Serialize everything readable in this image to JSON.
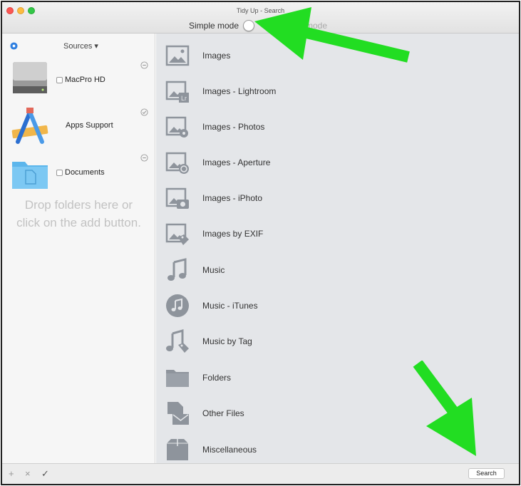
{
  "window": {
    "title": "Tidy Up - Search",
    "mode_simple": "Simple mode",
    "mode_advanced": "d mode"
  },
  "sidebar": {
    "sources_label": "Sources ▾",
    "items": [
      {
        "name": "MacPro HD",
        "icon": "hard-drive-icon"
      },
      {
        "name": "Apps Support",
        "icon": "applications-icon"
      },
      {
        "name": "Documents",
        "icon": "documents-folder-icon"
      }
    ],
    "drop_hint_line1": "Drop folders here or",
    "drop_hint_line2": "click on the add button."
  },
  "categories": [
    {
      "label": "Images",
      "icon": "image-icon"
    },
    {
      "label": "Images - Lightroom",
      "icon": "image-lightroom-icon"
    },
    {
      "label": "Images - Photos",
      "icon": "image-photos-icon"
    },
    {
      "label": "Images - Aperture",
      "icon": "image-aperture-icon"
    },
    {
      "label": "Images - iPhoto",
      "icon": "image-iphoto-icon"
    },
    {
      "label": "Images by EXIF",
      "icon": "image-exif-icon"
    },
    {
      "label": "Music",
      "icon": "music-note-icon"
    },
    {
      "label": "Music - iTunes",
      "icon": "itunes-icon"
    },
    {
      "label": "Music by Tag",
      "icon": "music-tag-icon"
    },
    {
      "label": "Folders",
      "icon": "folder-icon"
    },
    {
      "label": "Other Files",
      "icon": "other-files-icon"
    },
    {
      "label": "Miscellaneous",
      "icon": "miscellaneous-box-icon"
    }
  ],
  "bottombar": {
    "add": "+",
    "remove": "×",
    "check": "✓",
    "search_label": "Search"
  },
  "colors": {
    "arrow": "#22dd22",
    "icon_gray": "#8e949c",
    "accent_blue": "#2f7fe0"
  }
}
